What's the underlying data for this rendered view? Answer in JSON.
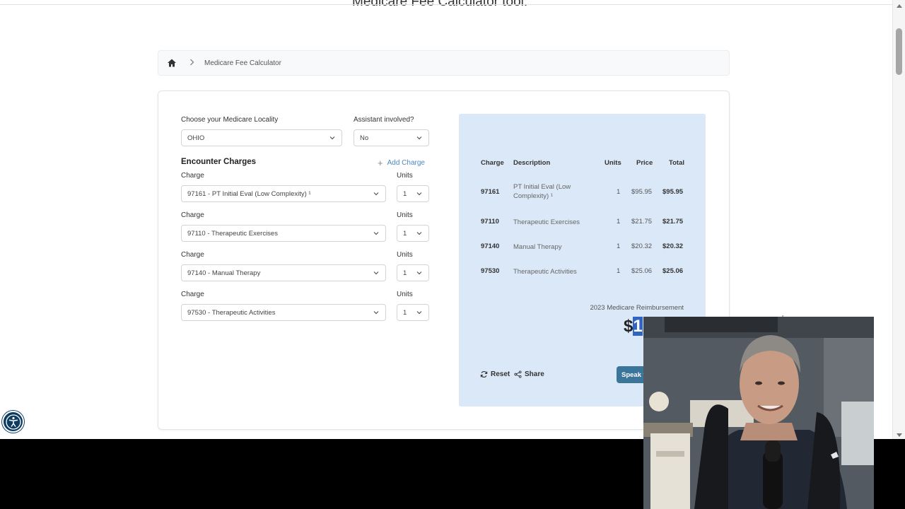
{
  "page": {
    "heading": "Medicare Fee Calculator tool."
  },
  "breadcrumb": {
    "current": "Medicare Fee Calculator"
  },
  "form": {
    "locality_label": "Choose your Medicare Locality",
    "locality_value": "OHIO",
    "assistant_label": "Assistant involved?",
    "assistant_value": "No",
    "encounter_title": "Encounter Charges",
    "add_charge_label": "Add Charge",
    "charges": [
      {
        "charge_label": "Charge",
        "units_label": "Units",
        "charge_value": "97161 - PT Initial Eval (Low Complexity) ¹",
        "units_value": "1"
      },
      {
        "charge_label": "Charge",
        "units_label": "Units",
        "charge_value": "97110 - Therapeutic Exercises",
        "units_value": "1"
      },
      {
        "charge_label": "Charge",
        "units_label": "Units",
        "charge_value": "97140 - Manual Therapy",
        "units_value": "1"
      },
      {
        "charge_label": "Charge",
        "units_label": "Units",
        "charge_value": "97530 - Therapeutic Activities",
        "units_value": "1"
      }
    ]
  },
  "summary": {
    "headers": {
      "charge": "Charge",
      "description": "Description",
      "units": "Units",
      "price": "Price",
      "total": "Total"
    },
    "rows": [
      {
        "code": "97161",
        "description": "PT Initial Eval (Low Complexity) ¹",
        "units": "1",
        "price": "$95.95",
        "total": "$95.95"
      },
      {
        "code": "97110",
        "description": "Therapeutic Exercises",
        "units": "1",
        "price": "$21.75",
        "total": "$21.75"
      },
      {
        "code": "97140",
        "description": "Manual Therapy",
        "units": "1",
        "price": "$20.32",
        "total": "$20.32"
      },
      {
        "code": "97530",
        "description": "Therapeutic Activities",
        "units": "1",
        "price": "$25.06",
        "total": "$25.06"
      }
    ],
    "reimbursement_label": "2023 Medicare Reimbursement",
    "amount_prefix": "$",
    "amount_visible": "1",
    "reset_label": "Reset",
    "share_label": "Share",
    "speak_label": "Speak t"
  },
  "colors": {
    "panel_bg": "#dbe8f8",
    "accent": "#3b7599",
    "link": "#4b88c0",
    "highlight": "#2f64c4"
  },
  "icons": [
    "home-icon",
    "chevron-right-icon",
    "chevron-down-icon",
    "plus-icon",
    "reset-icon",
    "share-icon",
    "accessibility-icon"
  ]
}
